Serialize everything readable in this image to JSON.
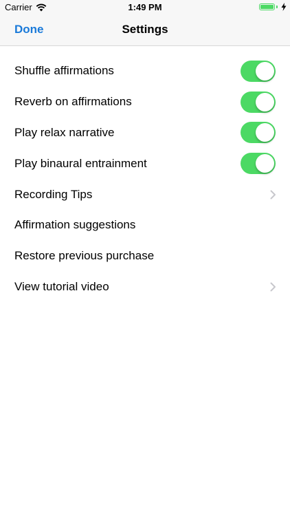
{
  "status_bar": {
    "carrier": "Carrier",
    "time": "1:49 PM",
    "wifi_icon": "wifi-icon",
    "battery_icon": "battery-icon",
    "charging_icon": "bolt-icon",
    "battery_level": 1.0,
    "battery_color": "#4cd964"
  },
  "nav": {
    "done_label": "Done",
    "title": "Settings",
    "accent_color": "#1a7ad9"
  },
  "settings": {
    "toggle_on_color": "#4cd964",
    "rows": [
      {
        "label": "Shuffle affirmations",
        "toggle": true
      },
      {
        "label": "Reverb on affirmations",
        "toggle": true
      },
      {
        "label": "Play relax narrative",
        "toggle": true
      },
      {
        "label": "Play binaural entrainment",
        "toggle": true
      },
      {
        "label": "Recording Tips",
        "chevron": true
      },
      {
        "label": "Affirmation suggestions"
      },
      {
        "label": "Restore previous purchase"
      },
      {
        "label": "View tutorial video",
        "chevron": true
      }
    ]
  }
}
